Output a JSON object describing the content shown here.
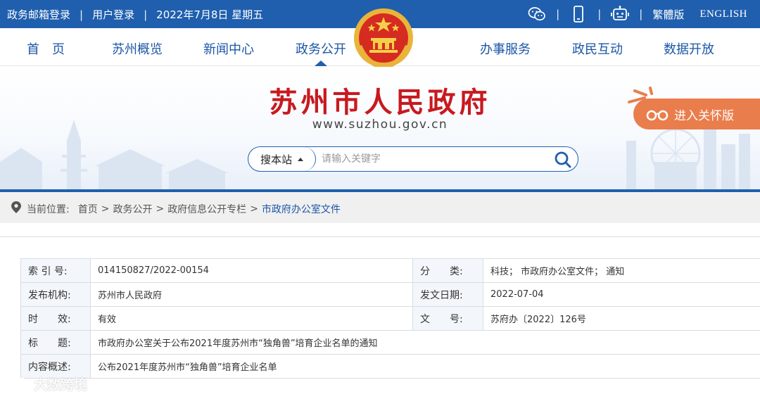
{
  "topbar": {
    "mail_link": "政务邮箱登录",
    "login_link": "用户登录",
    "date_text": "2022年7月8日 星期五",
    "traditional_link": "繁體版",
    "english_link": "ENGLISH",
    "icons": [
      "wechat-icon",
      "mobile-icon",
      "robot-icon"
    ]
  },
  "nav": {
    "items": [
      "首　页",
      "苏州概览",
      "新闻中心",
      "政务公开",
      "办事服务",
      "政民互动",
      "数据开放"
    ]
  },
  "banner": {
    "title": "苏州市人民政府",
    "url": "www.suzhou.gov.cn",
    "care_button": "进入关怀版",
    "search_scope": "搜本站",
    "search_placeholder": "请输入关键字"
  },
  "breadcrumb": {
    "label": "当前位置:",
    "items": [
      "首页",
      "政务公开",
      "政府信息公开专栏",
      "市政府办公室文件"
    ]
  },
  "info": {
    "index_label": "索 引 号:",
    "index_value": "014150827/2022-00154",
    "category_label": "分　　类:",
    "category_value": "科技；  市政府办公室文件；  通知",
    "org_label": "发布机构:",
    "org_value": "苏州市人民政府",
    "date_label": "发文日期:",
    "date_value": "2022-07-04",
    "validity_label": "时　　效:",
    "validity_value": "有效",
    "docno_label": "文　　号:",
    "docno_value": "苏府办〔2022〕126号",
    "title_label": "标　　题:",
    "title_value": "市政府办公室关于公布2021年度苏州市“独角兽”培育企业名单的通知",
    "summary_label": "内容概述:",
    "summary_value": "公布2021年度苏州市“独角兽”培育企业名单"
  },
  "watermark": {
    "text": "大数跨境"
  },
  "colors": {
    "brand_blue": "#1f5fae",
    "title_red": "#c8191f",
    "care_orange": "#ea7d4c"
  }
}
